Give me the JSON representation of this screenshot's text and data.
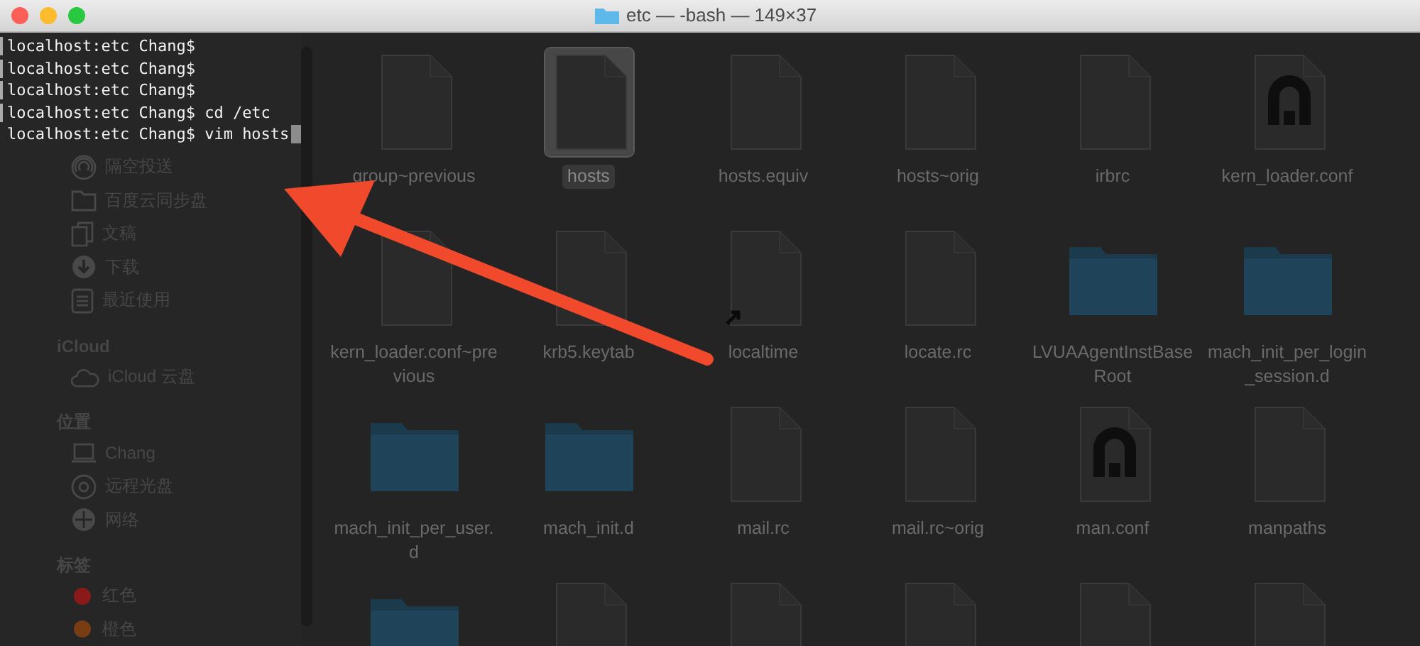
{
  "window": {
    "title": "etc — -bash — 149×37"
  },
  "terminal": {
    "lines": [
      {
        "text": "localhost:etc Chang$",
        "marked": true,
        "cursor": false
      },
      {
        "text": "localhost:etc Chang$",
        "marked": true,
        "cursor": false
      },
      {
        "text": "localhost:etc Chang$",
        "marked": true,
        "cursor": false
      },
      {
        "text": "localhost:etc Chang$ cd /etc",
        "marked": true,
        "cursor": false
      },
      {
        "text": "localhost:etc Chang$ vim hosts",
        "marked": false,
        "cursor": true
      }
    ]
  },
  "sidebar": {
    "items": [
      {
        "kind": "airdrop",
        "label": "隔空投送"
      },
      {
        "kind": "folder",
        "label": "百度云同步盘"
      },
      {
        "kind": "document",
        "label": "文稿"
      },
      {
        "kind": "download",
        "label": "下载"
      },
      {
        "kind": "recent",
        "label": "最近使用"
      },
      {
        "kind": "header",
        "label": "iCloud"
      },
      {
        "kind": "cloud",
        "label": "iCloud 云盘"
      },
      {
        "kind": "header",
        "label": "位置"
      },
      {
        "kind": "computer",
        "label": "Chang"
      },
      {
        "kind": "disc",
        "label": "远程光盘"
      },
      {
        "kind": "network",
        "label": "网络"
      },
      {
        "kind": "header",
        "label": "标签"
      },
      {
        "kind": "tag",
        "label": "红色",
        "color": "#8a1a1a"
      },
      {
        "kind": "tag",
        "label": "橙色",
        "color": "#7a3c12"
      }
    ]
  },
  "files": [
    {
      "kind": "file",
      "name": "group~previous",
      "selected": false
    },
    {
      "kind": "file",
      "name": "hosts",
      "selected": true
    },
    {
      "kind": "file",
      "name": "hosts.equiv",
      "selected": false
    },
    {
      "kind": "file",
      "name": "hosts~orig",
      "selected": false
    },
    {
      "kind": "file",
      "name": "irbrc",
      "selected": false
    },
    {
      "kind": "conf",
      "name": "kern_loader.conf",
      "selected": false
    },
    {
      "kind": "file",
      "name": "kern_loader.conf~previous",
      "selected": false
    },
    {
      "kind": "file",
      "name": "krb5.keytab",
      "selected": false
    },
    {
      "kind": "alias",
      "name": "localtime",
      "selected": false
    },
    {
      "kind": "file",
      "name": "locate.rc",
      "selected": false
    },
    {
      "kind": "folder",
      "name": "LVUAAgentInstBaseRoot",
      "selected": false
    },
    {
      "kind": "folder",
      "name": "mach_init_per_login_session.d",
      "selected": false
    },
    {
      "kind": "folder",
      "name": "mach_init_per_user.d",
      "selected": false
    },
    {
      "kind": "folder",
      "name": "mach_init.d",
      "selected": false
    },
    {
      "kind": "file",
      "name": "mail.rc",
      "selected": false
    },
    {
      "kind": "file",
      "name": "mail.rc~orig",
      "selected": false
    },
    {
      "kind": "conf",
      "name": "man.conf",
      "selected": false
    },
    {
      "kind": "file",
      "name": "manpaths",
      "selected": false
    },
    {
      "kind": "folder",
      "selected": false
    },
    {
      "kind": "file",
      "selected": false
    },
    {
      "kind": "file",
      "selected": false
    },
    {
      "kind": "file",
      "selected": false
    },
    {
      "kind": "file",
      "selected": false
    },
    {
      "kind": "file",
      "selected": false
    }
  ]
}
